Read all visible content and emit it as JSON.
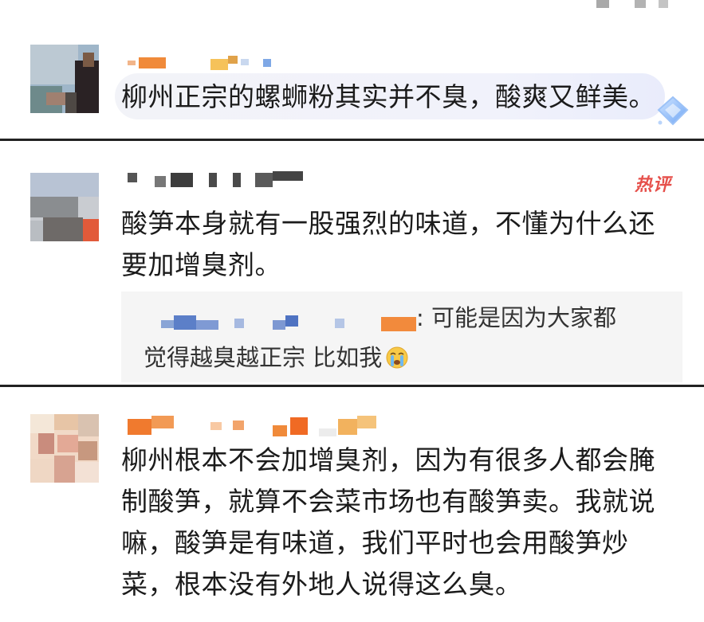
{
  "comments": [
    {
      "text": "柳州正宗的螺蛳粉其实并不臭，酸爽又鲜美。",
      "highlighted": true,
      "badge_icon": "diamond-icon"
    },
    {
      "badge": "热评",
      "line1": "酸笋本身就有一股强烈的味道，不懂为什么还",
      "line2": "要加增臭剂。",
      "reply": {
        "line1": ": 可能是因为大家都",
        "line2": "觉得越臭越正宗 比如我",
        "emoji": "crying-face-icon"
      }
    },
    {
      "line1": "柳州根本不会加增臭剂，因为有很多人都会腌",
      "line2": "制酸笋，就算不会菜市场也有酸笋卖。我就说",
      "line3": "嘛，酸笋是有味道，我们平时也会用酸笋炒",
      "line4": "菜，根本没有外地人说得这么臭。"
    }
  ],
  "colors": {
    "badge_red": "#e6504b",
    "divider": "#222222",
    "reply_bg": "#f5f5f5"
  }
}
